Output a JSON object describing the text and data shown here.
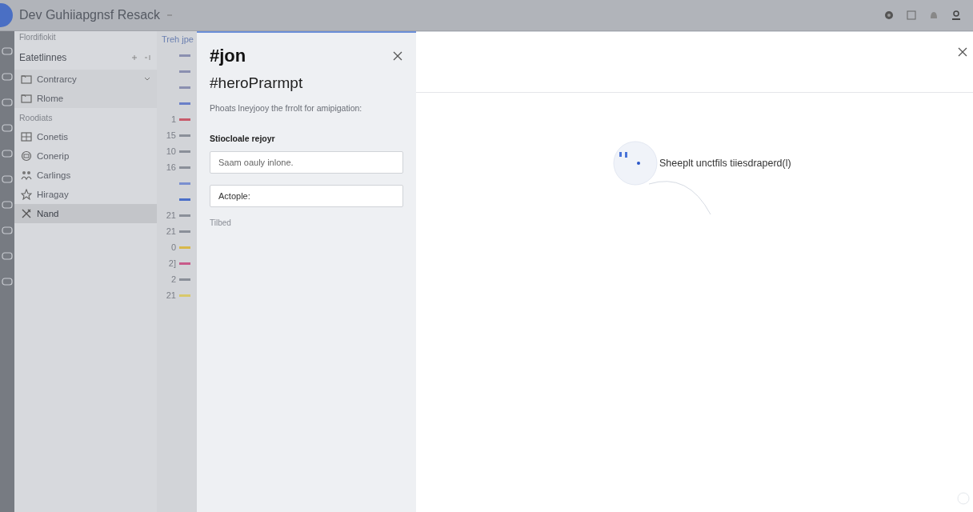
{
  "app": {
    "title": "Dev Guhiiapgnsf Resack"
  },
  "sidebar": {
    "header": "Flordifiokit",
    "sections": [
      {
        "title": "Eatetlinnes",
        "items": [
          {
            "label": "Contrarcy",
            "expandable": true,
            "selected": false
          },
          {
            "label": "Rlome",
            "expandable": false,
            "selected": false
          }
        ]
      },
      {
        "title": "Roodiats",
        "items": [
          {
            "label": "Conetis",
            "expandable": false,
            "selected": false
          },
          {
            "label": "Conerip",
            "expandable": false,
            "selected": false
          },
          {
            "label": "Carlings",
            "expandable": false,
            "selected": false
          },
          {
            "label": "Hiragay",
            "expandable": false,
            "selected": false
          },
          {
            "label": "Nand",
            "expandable": false,
            "selected": true
          }
        ]
      }
    ]
  },
  "editor": {
    "title": "Treh jpe",
    "lines": [
      {
        "color": "#8a8fb0"
      },
      {
        "color": "#8a8fb0"
      },
      {
        "color": "#8a8fb0"
      },
      {
        "color": "#6a7fc8"
      },
      {
        "number": "1",
        "color": "#c85a6a"
      },
      {
        "number": "15",
        "color": "#8a8f99"
      },
      {
        "number": "10",
        "color": "#8a8f99"
      },
      {
        "number": "16",
        "color": "#8a8f99"
      },
      {
        "color": "#7a8fd0"
      },
      {
        "color": "#4a6fc8"
      },
      {
        "number": "21",
        "color": "#8a8f99"
      },
      {
        "number": "21",
        "color": "#8a8f99"
      },
      {
        "number": "0",
        "color": "#d8b84a"
      },
      {
        "number": "2]",
        "color": "#c85a8a"
      },
      {
        "number": "2",
        "color": "#8a8f99"
      },
      {
        "number": "21",
        "color": "#d8c86a"
      }
    ]
  },
  "panel": {
    "title": "#jon",
    "subtitle": "#heroPrarmpt",
    "description": "Phoats lneyjooy the frrolt for amipigation:",
    "label": "Stiocloale rejoyr",
    "fields": [
      {
        "placeholder": "Saam oauly inlone."
      },
      {
        "value": "Actople:"
      }
    ],
    "note": "Tilbed"
  },
  "main": {
    "status": "Sheeplt unctfils tiiesdraperd(l)"
  }
}
